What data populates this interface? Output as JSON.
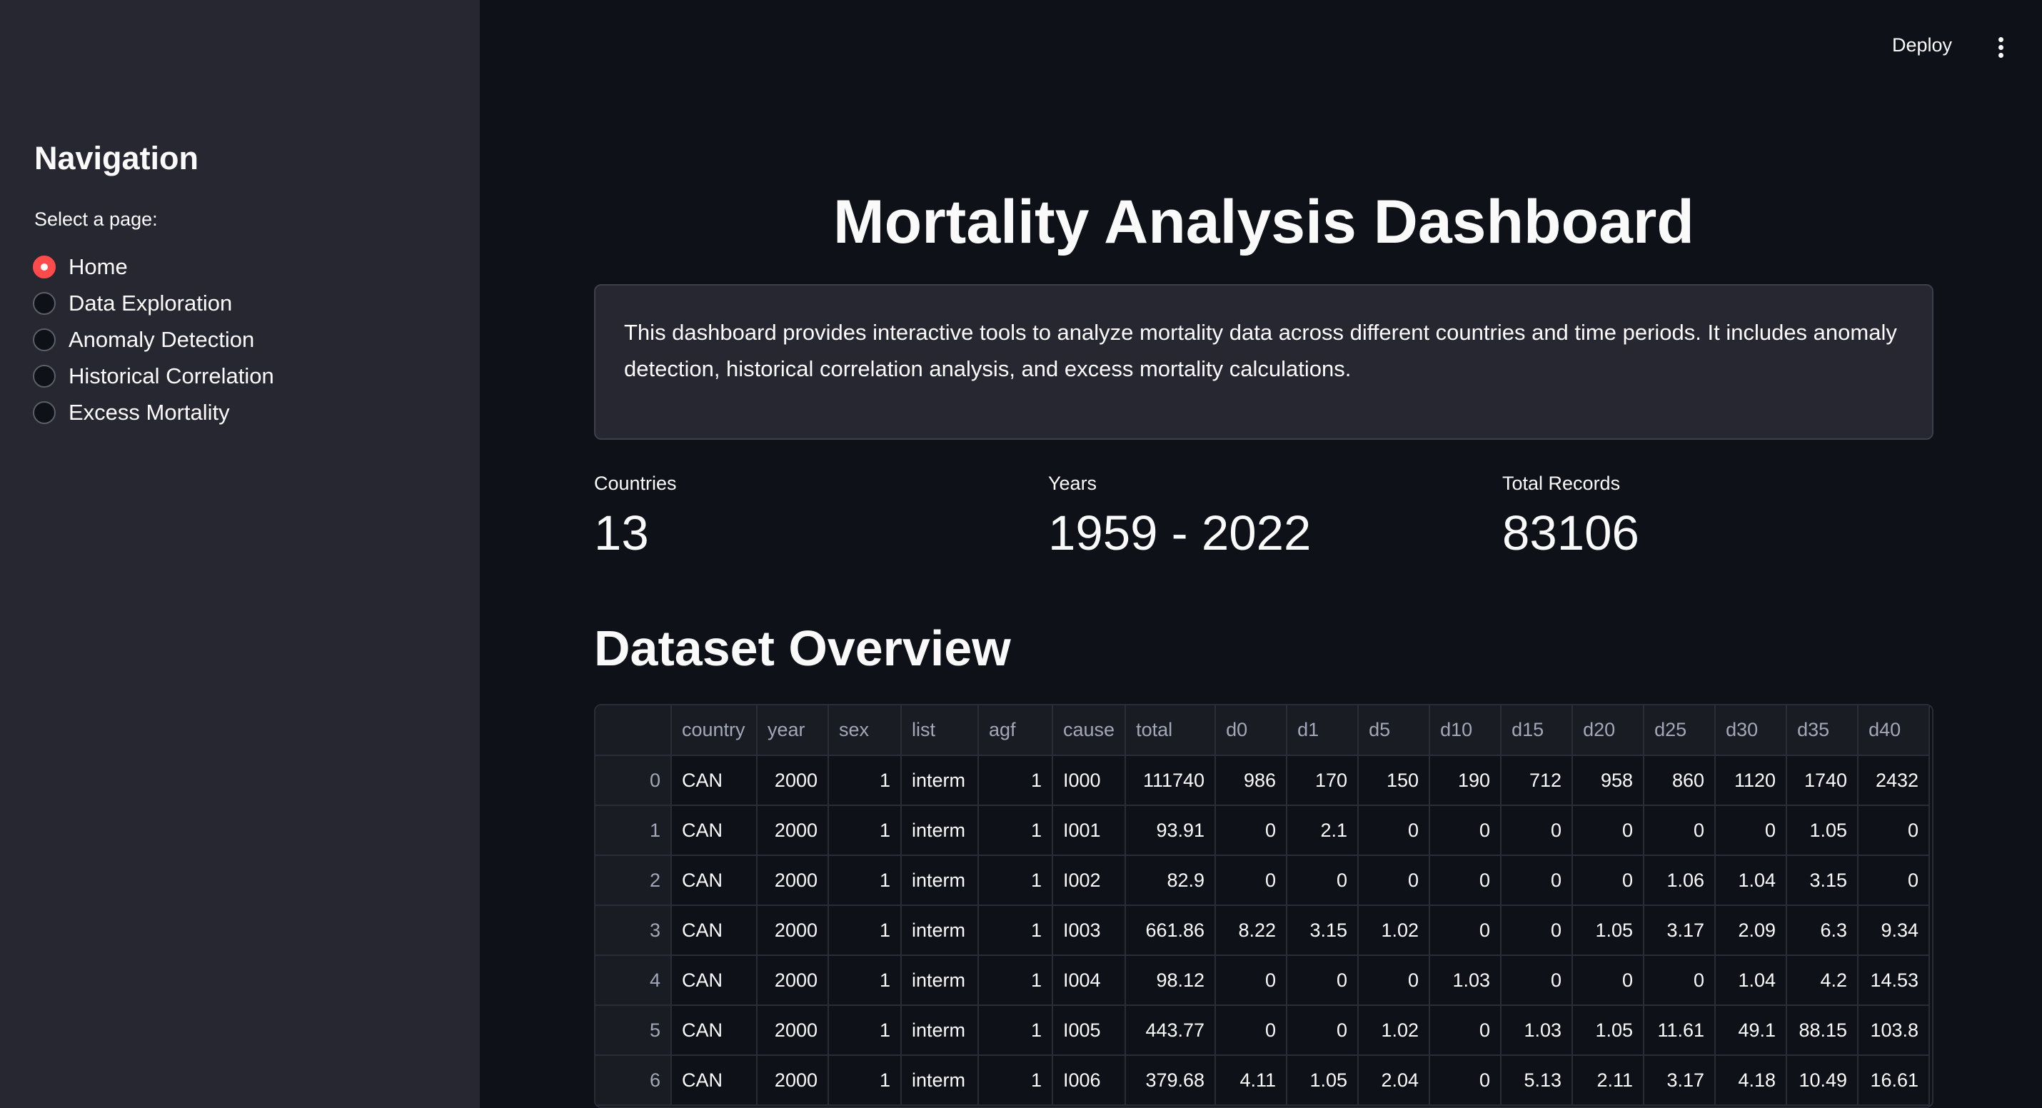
{
  "sidebar": {
    "title": "Navigation",
    "radio_label": "Select a page:",
    "options": [
      "Home",
      "Data Exploration",
      "Anomaly Detection",
      "Historical Correlation",
      "Excess Mortality"
    ],
    "selected": "Home"
  },
  "header": {
    "deploy_label": "Deploy",
    "menu_icon": "vertical-ellipsis-icon"
  },
  "main": {
    "title": "Mortality Analysis Dashboard",
    "info_text": "This dashboard provides interactive tools to analyze mortality data across different countries and time periods. It includes anomaly detection, historical correlation analysis, and excess mortality calculations.",
    "metrics": [
      {
        "label": "Countries",
        "value": "13"
      },
      {
        "label": "Years",
        "value": "1959 - 2022"
      },
      {
        "label": "Total Records",
        "value": "83106"
      }
    ],
    "section_title": "Dataset Overview"
  },
  "table": {
    "columns": [
      "",
      "country",
      "year",
      "sex",
      "list",
      "agf",
      "cause",
      "total",
      "d0",
      "d1",
      "d5",
      "d10",
      "d15",
      "d20",
      "d25",
      "d30",
      "d35",
      "d40"
    ],
    "rows": [
      [
        "0",
        "CAN",
        "2000",
        "1",
        "interm",
        "1",
        "I000",
        "111740",
        "986",
        "170",
        "150",
        "190",
        "712",
        "958",
        "860",
        "1120",
        "1740",
        "2432"
      ],
      [
        "1",
        "CAN",
        "2000",
        "1",
        "interm",
        "1",
        "I001",
        "93.91",
        "0",
        "2.1",
        "0",
        "0",
        "0",
        "0",
        "0",
        "0",
        "1.05",
        "0"
      ],
      [
        "2",
        "CAN",
        "2000",
        "1",
        "interm",
        "1",
        "I002",
        "82.9",
        "0",
        "0",
        "0",
        "0",
        "0",
        "0",
        "1.06",
        "1.04",
        "3.15",
        "0"
      ],
      [
        "3",
        "CAN",
        "2000",
        "1",
        "interm",
        "1",
        "I003",
        "661.86",
        "8.22",
        "3.15",
        "1.02",
        "0",
        "0",
        "1.05",
        "3.17",
        "2.09",
        "6.3",
        "9.34"
      ],
      [
        "4",
        "CAN",
        "2000",
        "1",
        "interm",
        "1",
        "I004",
        "98.12",
        "0",
        "0",
        "0",
        "1.03",
        "0",
        "0",
        "0",
        "1.04",
        "4.2",
        "14.53"
      ],
      [
        "5",
        "CAN",
        "2000",
        "1",
        "interm",
        "1",
        "I005",
        "443.77",
        "0",
        "0",
        "1.02",
        "0",
        "1.03",
        "1.05",
        "11.61",
        "49.1",
        "88.15",
        "103.8"
      ],
      [
        "6",
        "CAN",
        "2000",
        "1",
        "interm",
        "1",
        "I006",
        "379.68",
        "4.11",
        "1.05",
        "2.04",
        "0",
        "5.13",
        "2.11",
        "3.17",
        "4.18",
        "10.49",
        "16.61"
      ]
    ]
  }
}
